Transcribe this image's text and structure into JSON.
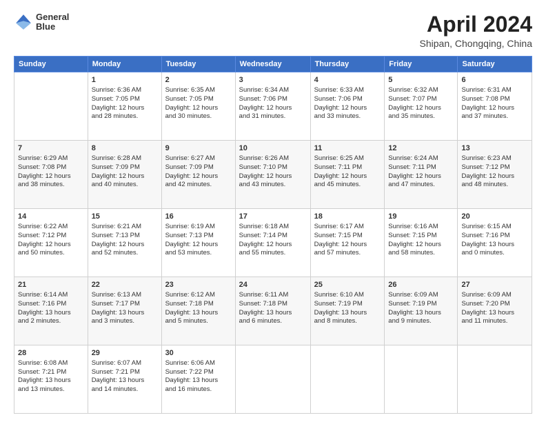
{
  "header": {
    "logo_line1": "General",
    "logo_line2": "Blue",
    "title": "April 2024",
    "subtitle": "Shipan, Chongqing, China"
  },
  "columns": [
    "Sunday",
    "Monday",
    "Tuesday",
    "Wednesday",
    "Thursday",
    "Friday",
    "Saturday"
  ],
  "weeks": [
    [
      {
        "num": "",
        "info": ""
      },
      {
        "num": "1",
        "info": "Sunrise: 6:36 AM\nSunset: 7:05 PM\nDaylight: 12 hours\nand 28 minutes."
      },
      {
        "num": "2",
        "info": "Sunrise: 6:35 AM\nSunset: 7:05 PM\nDaylight: 12 hours\nand 30 minutes."
      },
      {
        "num": "3",
        "info": "Sunrise: 6:34 AM\nSunset: 7:06 PM\nDaylight: 12 hours\nand 31 minutes."
      },
      {
        "num": "4",
        "info": "Sunrise: 6:33 AM\nSunset: 7:06 PM\nDaylight: 12 hours\nand 33 minutes."
      },
      {
        "num": "5",
        "info": "Sunrise: 6:32 AM\nSunset: 7:07 PM\nDaylight: 12 hours\nand 35 minutes."
      },
      {
        "num": "6",
        "info": "Sunrise: 6:31 AM\nSunset: 7:08 PM\nDaylight: 12 hours\nand 37 minutes."
      }
    ],
    [
      {
        "num": "7",
        "info": "Sunrise: 6:29 AM\nSunset: 7:08 PM\nDaylight: 12 hours\nand 38 minutes."
      },
      {
        "num": "8",
        "info": "Sunrise: 6:28 AM\nSunset: 7:09 PM\nDaylight: 12 hours\nand 40 minutes."
      },
      {
        "num": "9",
        "info": "Sunrise: 6:27 AM\nSunset: 7:09 PM\nDaylight: 12 hours\nand 42 minutes."
      },
      {
        "num": "10",
        "info": "Sunrise: 6:26 AM\nSunset: 7:10 PM\nDaylight: 12 hours\nand 43 minutes."
      },
      {
        "num": "11",
        "info": "Sunrise: 6:25 AM\nSunset: 7:11 PM\nDaylight: 12 hours\nand 45 minutes."
      },
      {
        "num": "12",
        "info": "Sunrise: 6:24 AM\nSunset: 7:11 PM\nDaylight: 12 hours\nand 47 minutes."
      },
      {
        "num": "13",
        "info": "Sunrise: 6:23 AM\nSunset: 7:12 PM\nDaylight: 12 hours\nand 48 minutes."
      }
    ],
    [
      {
        "num": "14",
        "info": "Sunrise: 6:22 AM\nSunset: 7:12 PM\nDaylight: 12 hours\nand 50 minutes."
      },
      {
        "num": "15",
        "info": "Sunrise: 6:21 AM\nSunset: 7:13 PM\nDaylight: 12 hours\nand 52 minutes."
      },
      {
        "num": "16",
        "info": "Sunrise: 6:19 AM\nSunset: 7:13 PM\nDaylight: 12 hours\nand 53 minutes."
      },
      {
        "num": "17",
        "info": "Sunrise: 6:18 AM\nSunset: 7:14 PM\nDaylight: 12 hours\nand 55 minutes."
      },
      {
        "num": "18",
        "info": "Sunrise: 6:17 AM\nSunset: 7:15 PM\nDaylight: 12 hours\nand 57 minutes."
      },
      {
        "num": "19",
        "info": "Sunrise: 6:16 AM\nSunset: 7:15 PM\nDaylight: 12 hours\nand 58 minutes."
      },
      {
        "num": "20",
        "info": "Sunrise: 6:15 AM\nSunset: 7:16 PM\nDaylight: 13 hours\nand 0 minutes."
      }
    ],
    [
      {
        "num": "21",
        "info": "Sunrise: 6:14 AM\nSunset: 7:16 PM\nDaylight: 13 hours\nand 2 minutes."
      },
      {
        "num": "22",
        "info": "Sunrise: 6:13 AM\nSunset: 7:17 PM\nDaylight: 13 hours\nand 3 minutes."
      },
      {
        "num": "23",
        "info": "Sunrise: 6:12 AM\nSunset: 7:18 PM\nDaylight: 13 hours\nand 5 minutes."
      },
      {
        "num": "24",
        "info": "Sunrise: 6:11 AM\nSunset: 7:18 PM\nDaylight: 13 hours\nand 6 minutes."
      },
      {
        "num": "25",
        "info": "Sunrise: 6:10 AM\nSunset: 7:19 PM\nDaylight: 13 hours\nand 8 minutes."
      },
      {
        "num": "26",
        "info": "Sunrise: 6:09 AM\nSunset: 7:19 PM\nDaylight: 13 hours\nand 9 minutes."
      },
      {
        "num": "27",
        "info": "Sunrise: 6:09 AM\nSunset: 7:20 PM\nDaylight: 13 hours\nand 11 minutes."
      }
    ],
    [
      {
        "num": "28",
        "info": "Sunrise: 6:08 AM\nSunset: 7:21 PM\nDaylight: 13 hours\nand 13 minutes."
      },
      {
        "num": "29",
        "info": "Sunrise: 6:07 AM\nSunset: 7:21 PM\nDaylight: 13 hours\nand 14 minutes."
      },
      {
        "num": "30",
        "info": "Sunrise: 6:06 AM\nSunset: 7:22 PM\nDaylight: 13 hours\nand 16 minutes."
      },
      {
        "num": "",
        "info": ""
      },
      {
        "num": "",
        "info": ""
      },
      {
        "num": "",
        "info": ""
      },
      {
        "num": "",
        "info": ""
      }
    ]
  ]
}
